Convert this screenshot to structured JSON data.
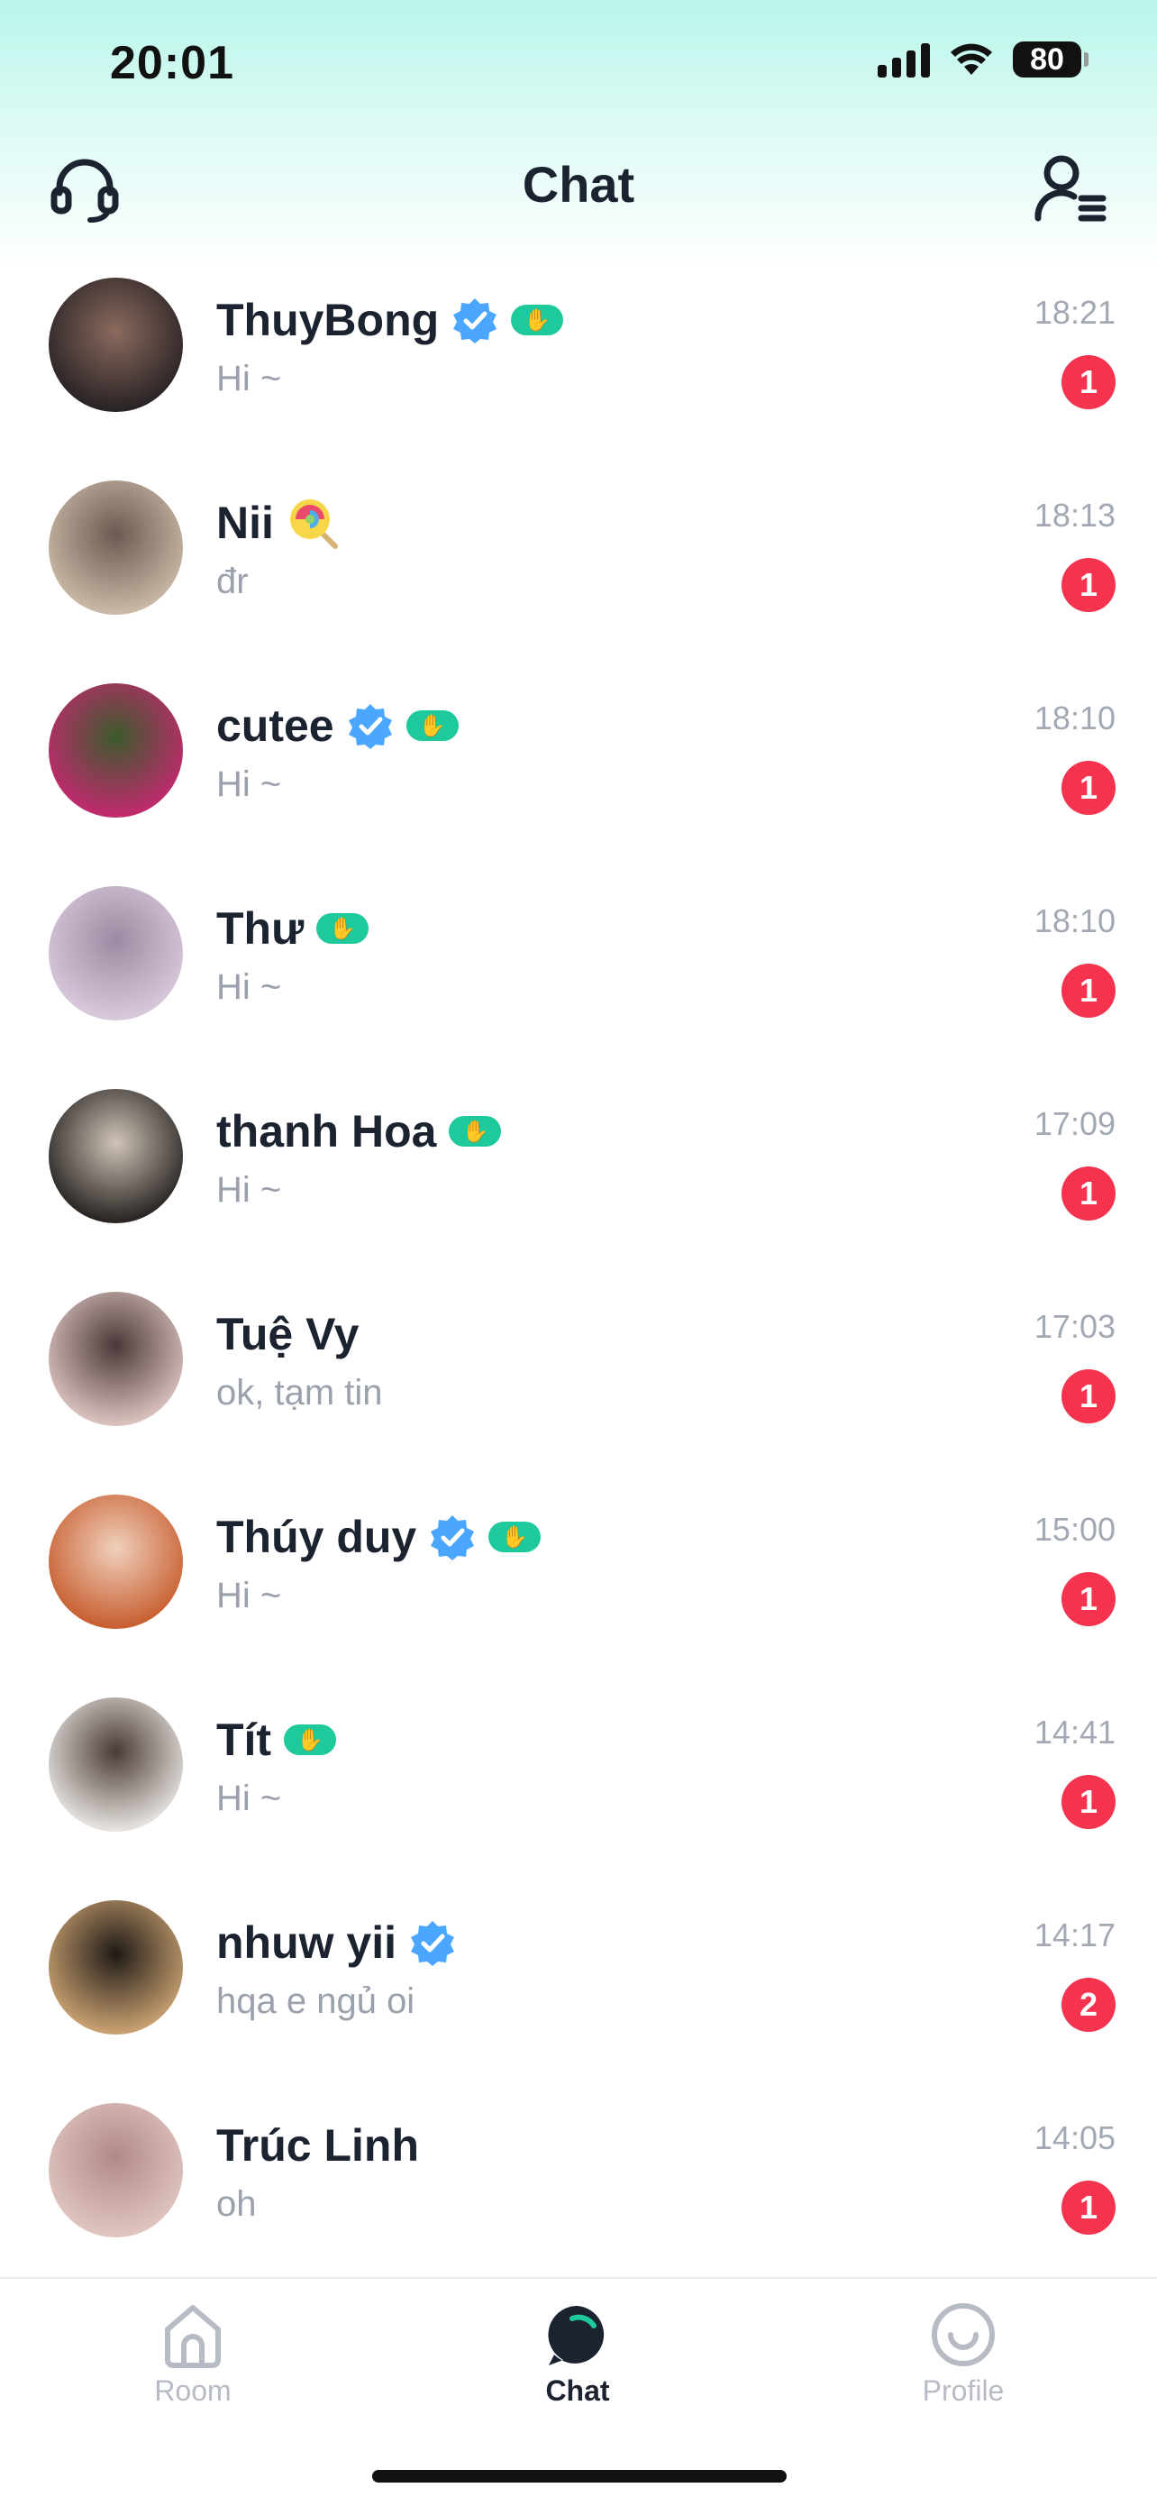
{
  "status_bar": {
    "time": "20:01",
    "battery": "80"
  },
  "header": {
    "title": "Chat"
  },
  "chats": [
    {
      "name": "ThuyBong",
      "preview": "Hi ~",
      "time": "18:21",
      "unread": "1",
      "verified": true,
      "wave": true,
      "avatar_colors": [
        "#2a2325",
        "#8a6a5e"
      ]
    },
    {
      "name": "Nii",
      "preview": "đr",
      "time": "18:13",
      "unread": "1",
      "verified": false,
      "wave": false,
      "lolly": true,
      "avatar_colors": [
        "#c9b8a6",
        "#6b5a50"
      ]
    },
    {
      "name": " cutee",
      "preview": "Hi ~",
      "time": "18:10",
      "unread": "1",
      "verified": true,
      "wave": true,
      "avatar_colors": [
        "#c02a6e",
        "#3c5a2c"
      ]
    },
    {
      "name": "Thư",
      "preview": "Hi ~",
      "time": "18:10",
      "unread": "1",
      "verified": false,
      "wave": true,
      "avatar_colors": [
        "#d8c8dc",
        "#9d8aa2"
      ]
    },
    {
      "name": "thanh Hoa",
      "preview": "Hi ~",
      "time": "17:09",
      "unread": "1",
      "verified": false,
      "wave": true,
      "avatar_colors": [
        "#2a2523",
        "#cfc4b8"
      ]
    },
    {
      "name": "Tuệ Vy",
      "preview": "ok, tạm tin",
      "time": "17:03",
      "unread": "1",
      "verified": false,
      "wave": false,
      "avatar_colors": [
        "#d9c1bd",
        "#4a3838"
      ]
    },
    {
      "name": "Thúy duy",
      "preview": "Hi ~",
      "time": "15:00",
      "unread": "1",
      "verified": true,
      "wave": true,
      "avatar_colors": [
        "#c86032",
        "#f0d0bc"
      ]
    },
    {
      "name": "Tít",
      "preview": "Hi ~",
      "time": "14:41",
      "unread": "1",
      "verified": false,
      "wave": true,
      "avatar_colors": [
        "#e6e2de",
        "#4a3a34"
      ]
    },
    {
      "name": "nhuw yii",
      "preview": "hqa e ngủ oi",
      "time": "14:17",
      "unread": "2",
      "verified": true,
      "wave": false,
      "avatar_colors": [
        "#c8a070",
        "#1f1a16"
      ]
    },
    {
      "name": "Trúc Linh",
      "preview": "oh",
      "time": "14:05",
      "unread": "1",
      "verified": false,
      "wave": false,
      "avatar_colors": [
        "#e0c4c0",
        "#b08a88"
      ]
    }
  ],
  "nav": {
    "room": "Room",
    "chat": "Chat",
    "profile": "Profile",
    "active_color": "#1c2330",
    "inactive_color": "#b7bcc4",
    "accent": "#1ec99b"
  }
}
